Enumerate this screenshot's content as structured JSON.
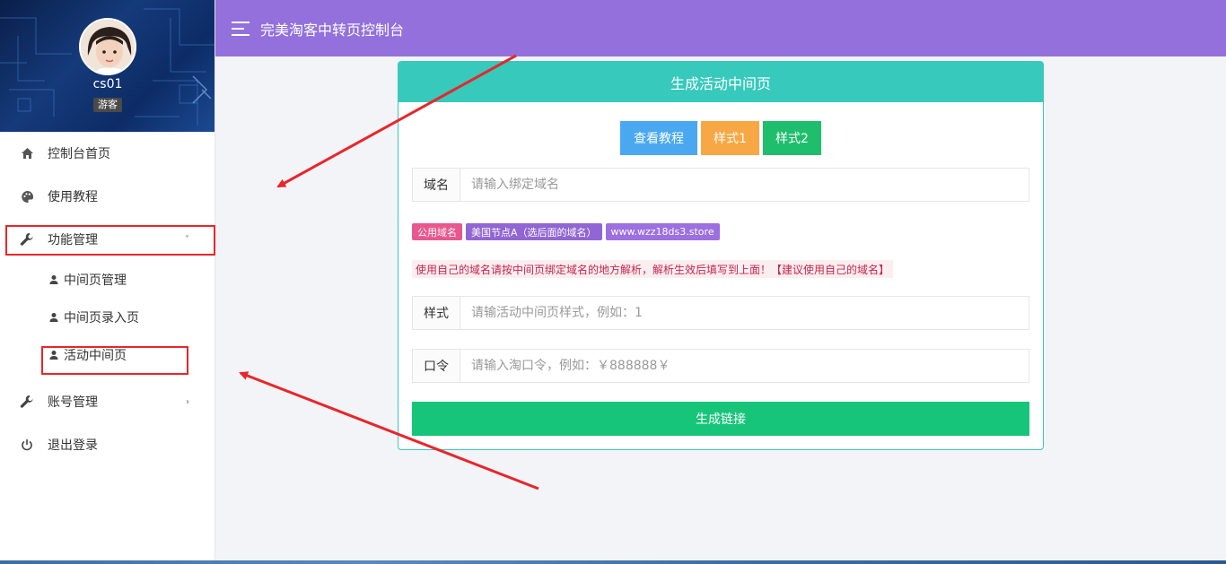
{
  "sidebar": {
    "username": "cs01",
    "role": "游客",
    "items": [
      {
        "label": "控制台首页",
        "icon": "home-icon"
      },
      {
        "label": "使用教程",
        "icon": "palette-icon"
      },
      {
        "label": "功能管理",
        "icon": "wrench-icon",
        "caret": "˅"
      },
      {
        "label": "账号管理",
        "icon": "wrench-icon",
        "caret": "›"
      },
      {
        "label": "退出登录",
        "icon": "power-icon"
      }
    ],
    "subitems": [
      {
        "label": "中间页管理",
        "icon": "user-icon"
      },
      {
        "label": "中间页录入页",
        "icon": "user-icon"
      },
      {
        "label": "活动中间页",
        "icon": "user-icon"
      }
    ]
  },
  "topbar": {
    "title": "完美淘客中转页控制台"
  },
  "panel": {
    "title": "生成活动中间页",
    "buttons": {
      "tutorial": "查看教程",
      "style1": "样式1",
      "style2": "样式2"
    },
    "domain": {
      "label": "域名",
      "placeholder": "请输入绑定域名",
      "value": ""
    },
    "tags": [
      "公用域名",
      "美国节点A（选后面的域名）",
      "www.wzz18ds3.store"
    ],
    "note": "使用自己的域名请按中间页绑定域名的地方解析，解析生效后填写到上面！【建议使用自己的域名】",
    "style": {
      "label": "样式",
      "placeholder": "请输活动中间页样式，例如：1",
      "value": ""
    },
    "password": {
      "label": "口令",
      "placeholder": "请输入淘口令，例如：￥888888￥",
      "value": ""
    },
    "generate": "生成链接"
  },
  "colors": {
    "topbar": "#9370db",
    "panel_header": "#36c9bc",
    "primary_green": "#17c57a",
    "highlight": "#e8262b"
  }
}
